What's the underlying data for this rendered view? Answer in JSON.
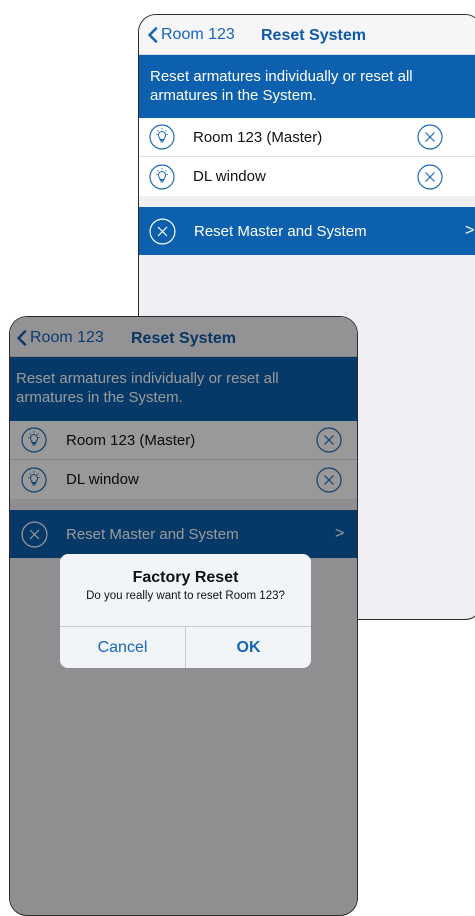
{
  "screens": [
    {
      "nav": {
        "back_label": "Room 123",
        "title": "Reset System"
      },
      "info": "Reset armatures individually or reset all armatures in the System.",
      "devices": [
        {
          "label": "Room 123 (Master)"
        },
        {
          "label": "DL window"
        }
      ],
      "reset_action": {
        "label": "Reset Master and System"
      }
    },
    {
      "nav": {
        "back_label": "Room 123",
        "title": "Reset System"
      },
      "info": "Reset armatures individually or reset all armatures in the System.",
      "devices": [
        {
          "label": "Room 123 (Master)"
        },
        {
          "label": "DL window"
        }
      ],
      "reset_action": {
        "label": "Reset Master and System"
      }
    }
  ],
  "dialog": {
    "title": "Factory Reset",
    "message": "Do you really want to reset Room 123?",
    "cancel_label": "Cancel",
    "ok_label": "OK"
  },
  "icons": {
    "back": "chevron-left-icon",
    "device": "lightbulb-icon",
    "remove": "close-circle-icon",
    "forward": "chevron-right-icon"
  },
  "colors": {
    "accent_blue": "#0d60ad",
    "link_blue": "#1565b8",
    "background": "#efeff4"
  }
}
